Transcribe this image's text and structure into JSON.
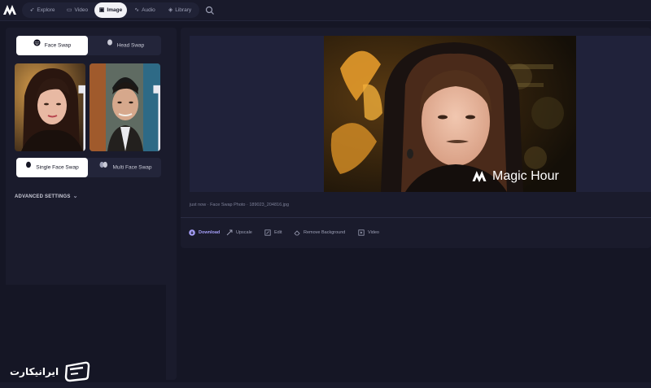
{
  "nav": {
    "tabs": [
      {
        "label": "Explore",
        "icon": "compass-icon"
      },
      {
        "label": "Video",
        "icon": "video-icon"
      },
      {
        "label": "Image",
        "icon": "image-icon",
        "active": true
      },
      {
        "label": "Audio",
        "icon": "audio-icon"
      },
      {
        "label": "Library",
        "icon": "library-icon"
      }
    ]
  },
  "left": {
    "mode_tabs": [
      "Face Swap",
      "Head Swap"
    ],
    "swap_tabs": [
      "Single Face Swap",
      "Multi Face Swap"
    ],
    "advanced_label": "ADVANCED SETTINGS"
  },
  "result": {
    "watermark": "Magic Hour",
    "meta": "just now · Face Swap Photo · 189023_204816.jpg",
    "actions": [
      "Download",
      "Upscale",
      "Edit",
      "Remove Background",
      "Video"
    ]
  },
  "site_watermark": "ایرانیکارت",
  "colors": {
    "background": "#151625",
    "panel": "#1a1b2c",
    "accent": "#a49ef7",
    "active_tab": "#f2f2f6"
  }
}
